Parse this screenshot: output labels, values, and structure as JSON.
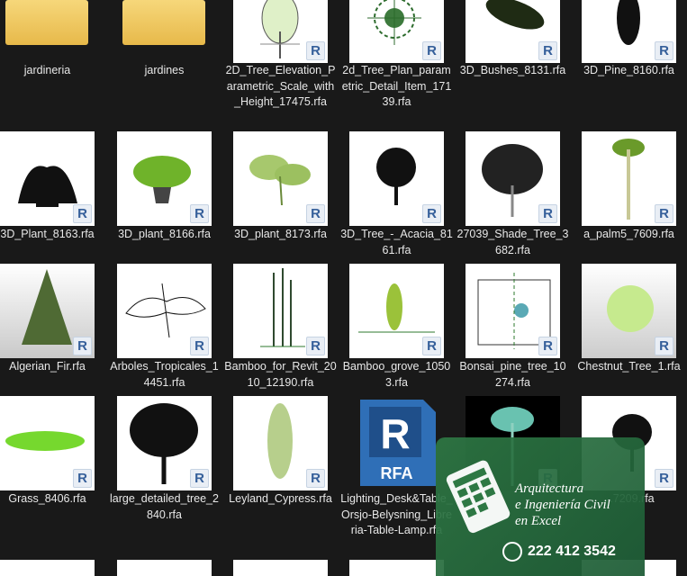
{
  "files": [
    {
      "name": "jardineria",
      "kind": "folder"
    },
    {
      "name": "jardines",
      "kind": "folder"
    },
    {
      "name": "2D_Tree_Elevation_Parametric_Scale_with_Height_17475.rfa",
      "kind": "rfa",
      "icon": "tree-elevation-icon"
    },
    {
      "name": "2d_Tree_Plan_parametric_Detail_Item_17139.rfa",
      "kind": "rfa",
      "icon": "tree-plan-icon"
    },
    {
      "name": "3D_Bushes_8131.rfa",
      "kind": "rfa",
      "icon": "bushes-icon"
    },
    {
      "name": "3D_Pine_8160.rfa",
      "kind": "rfa",
      "icon": "pine-icon"
    },
    {
      "name": "3D_Plant_8163.rfa",
      "kind": "rfa",
      "icon": "plant-icon"
    },
    {
      "name": "3D_plant_8166.rfa",
      "kind": "rfa",
      "icon": "potted-plant-icon"
    },
    {
      "name": "3D_plant_8173.rfa",
      "kind": "rfa",
      "icon": "leafy-plant-icon"
    },
    {
      "name": "3D_Tree_-_Acacia_8161.rfa",
      "kind": "rfa",
      "icon": "acacia-icon"
    },
    {
      "name": "27039_Shade_Tree_3682.rfa",
      "kind": "rfa",
      "icon": "shade-tree-icon"
    },
    {
      "name": "a_palm5_7609.rfa",
      "kind": "rfa",
      "icon": "palm-icon"
    },
    {
      "name": "Algerian_Fir.rfa",
      "kind": "rfa",
      "icon": "fir-icon"
    },
    {
      "name": "Arboles_Tropicales_14451.rfa",
      "kind": "rfa",
      "icon": "tropical-tree-outline-icon"
    },
    {
      "name": "Bamboo_for_Revit_2010_12190.rfa",
      "kind": "rfa",
      "icon": "bamboo-icon"
    },
    {
      "name": "Bamboo_grove_10503.rfa",
      "kind": "rfa",
      "icon": "bamboo-grove-icon"
    },
    {
      "name": "Bonsai_pine_tree_10274.rfa",
      "kind": "rfa",
      "icon": "bonsai-icon"
    },
    {
      "name": "Chestnut_Tree_1.rfa",
      "kind": "rfa",
      "icon": "chestnut-icon"
    },
    {
      "name": "Grass_8406.rfa",
      "kind": "rfa",
      "icon": "grass-icon"
    },
    {
      "name": "large_detailed_tree_2840.rfa",
      "kind": "rfa",
      "icon": "large-tree-icon"
    },
    {
      "name": "Leyland_Cypress.rfa",
      "kind": "rfa",
      "icon": "cypress-icon"
    },
    {
      "name": "Lighting_Desk&Table_Orsjo-Belysning_Libreria-Table-Lamp.rfa",
      "kind": "rfa-file",
      "icon": "rfa-file-icon"
    },
    {
      "name": "",
      "kind": "rfa",
      "icon": "dark-palm-icon"
    },
    {
      "name": "...7209.rfa",
      "kind": "rfa",
      "icon": "dark-tree-icon"
    }
  ],
  "badge_letter": "R",
  "rfa_file_label": "RFA",
  "overlay": {
    "line1": "Arquitectura",
    "line2": "e Ingeniería Civil",
    "line3": "en Excel",
    "phone": "222 412 3542"
  },
  "colors": {
    "background": "#191919",
    "folder": "#f0c85a",
    "overlay": "#2e7844",
    "revit_blue": "#355f9a"
  }
}
